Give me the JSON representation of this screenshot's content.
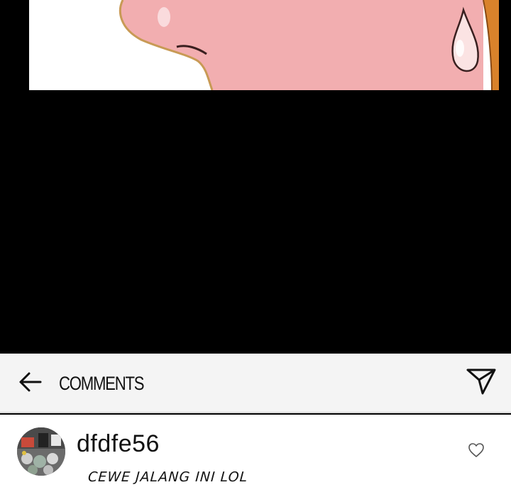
{
  "header": {
    "title": "COMMENTS",
    "back_icon": "arrow-left-icon",
    "share_icon": "paper-plane-icon"
  },
  "comments": [
    {
      "username": "dfdfe56",
      "text": "CEWE JALANG INI LOL",
      "avatar_icon": "user-avatar",
      "like_icon": "heart-outline-icon"
    }
  ],
  "colors": {
    "background": "#000000",
    "header_background": "#f4f4f4",
    "comment_background": "#ffffff",
    "skin": "#f2aeb0",
    "hair": "#d9822b"
  }
}
